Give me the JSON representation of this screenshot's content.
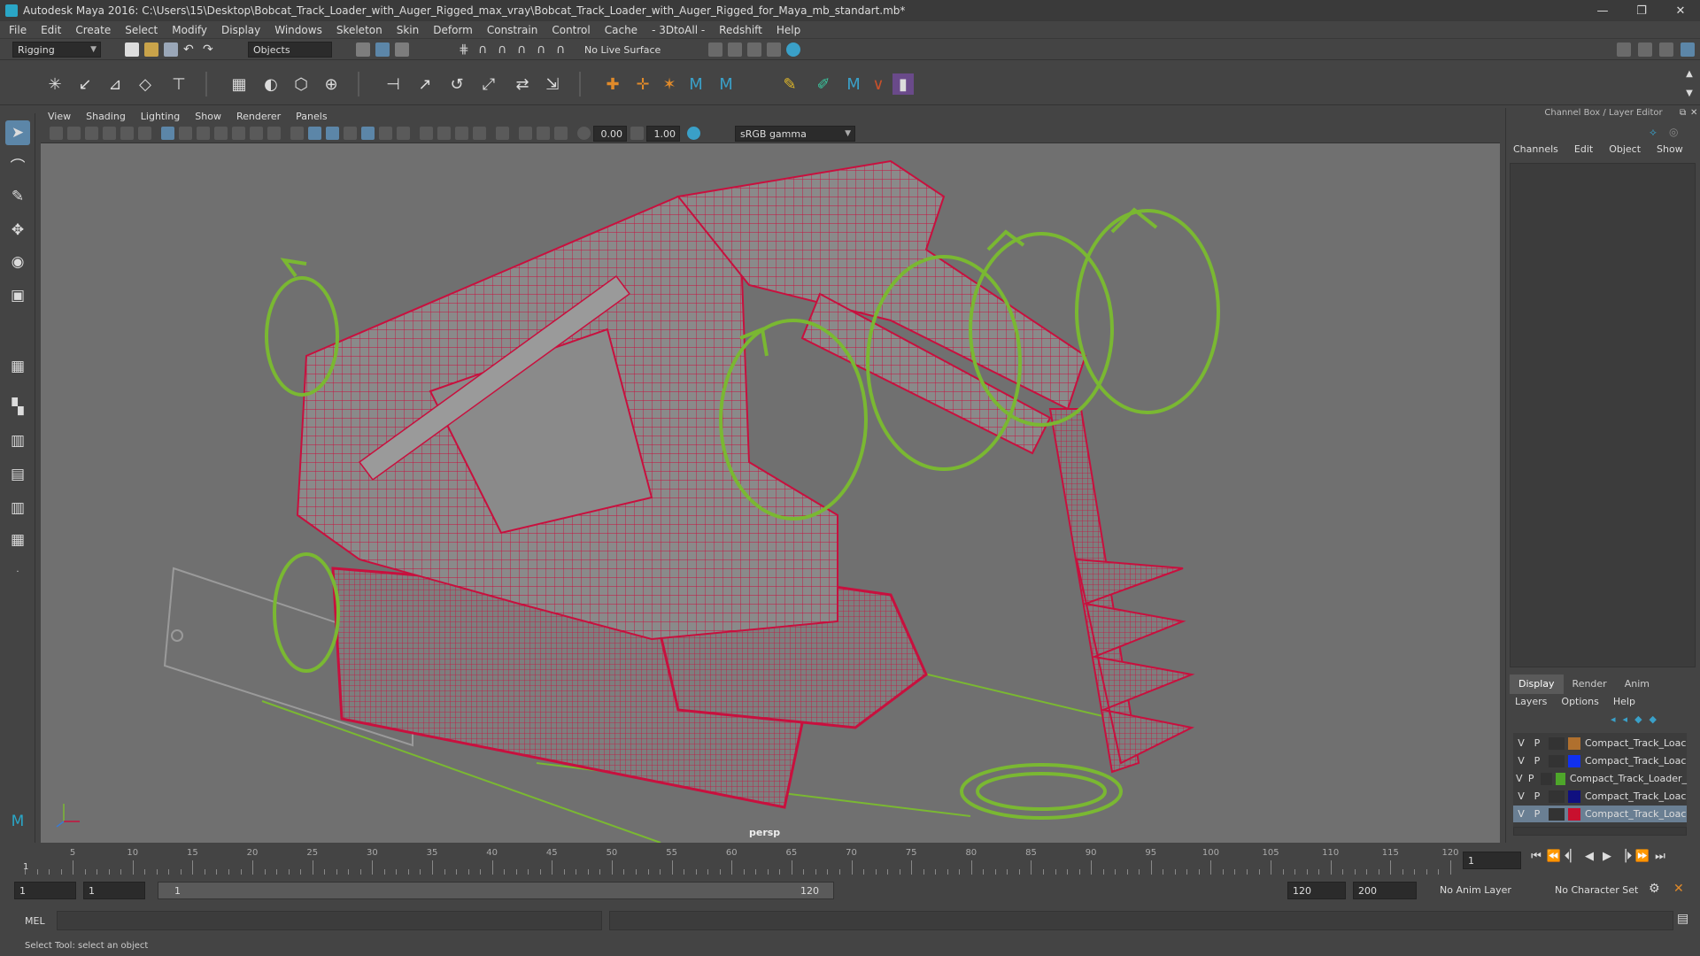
{
  "window": {
    "title": "Autodesk Maya 2016: C:\\Users\\15\\Desktop\\Bobcat_Track_Loader_with_Auger_Rigged_max_vray\\Bobcat_Track_Loader_with_Auger_Rigged_for_Maya_mb_standart.mb*",
    "min": "—",
    "max": "❐",
    "close": "✕"
  },
  "menubar": [
    "File",
    "Edit",
    "Create",
    "Select",
    "Modify",
    "Display",
    "Windows",
    "Skeleton",
    "Skin",
    "Deform",
    "Constrain",
    "Control",
    "Cache",
    "- 3DtoAll -",
    "Redshift",
    "Help"
  ],
  "statusline": {
    "mode": "Rigging",
    "selection_mode": "Objects",
    "live_surface": "No Live Surface"
  },
  "panel": {
    "menus": [
      "View",
      "Shading",
      "Lighting",
      "Show",
      "Renderer",
      "Panels"
    ],
    "exposure": "0.00",
    "gamma": "1.00",
    "colorspace": "sRGB gamma",
    "camera": "persp"
  },
  "channelbox": {
    "title": "Channel Box / Layer Editor",
    "menus": [
      "Channels",
      "Edit",
      "Object",
      "Show"
    ],
    "tabs": [
      "Display",
      "Render",
      "Anim"
    ],
    "layer_menus": [
      "Layers",
      "Options",
      "Help"
    ],
    "layers": [
      {
        "v": "V",
        "p": "P",
        "name": "Compact_Track_Loac",
        "color": "#b0702e"
      },
      {
        "v": "V",
        "p": "P",
        "name": "Compact_Track_Loac",
        "color": "#1030f0"
      },
      {
        "v": "V",
        "p": "P",
        "name": "Compact_Track_Loader_",
        "color": "#4ea62a"
      },
      {
        "v": "V",
        "p": "P",
        "name": "Compact_Track_Loac",
        "color": "#101080"
      },
      {
        "v": "V",
        "p": "P",
        "name": "Compact_Track_Loac",
        "color": "#c8102e"
      }
    ]
  },
  "timeline": {
    "ticks": [
      "5",
      "10",
      "15",
      "20",
      "25",
      "30",
      "35",
      "40",
      "45",
      "50",
      "55",
      "60",
      "65",
      "70",
      "75",
      "80",
      "85",
      "90",
      "95",
      "100",
      "105",
      "110",
      "115",
      "120"
    ],
    "start_label": "1",
    "current_frame": "1",
    "playback": [
      "⏮",
      "⏪",
      "⏴▏",
      "◀",
      "▶",
      "▕⏵",
      "⏩",
      "⏭"
    ]
  },
  "range": {
    "start": "1",
    "inner_start": "1",
    "slider_start": "1",
    "slider_end": "120",
    "end": "120",
    "total_end": "200",
    "anim_layer": "No Anim Layer",
    "character_set": "No Character Set"
  },
  "cmdline": {
    "label": "MEL"
  },
  "helpline": {
    "text": "Select Tool: select an object"
  },
  "colors": {
    "wire": "#c8103e",
    "controls": "#7ab832",
    "viewport_bg": "#707070"
  }
}
